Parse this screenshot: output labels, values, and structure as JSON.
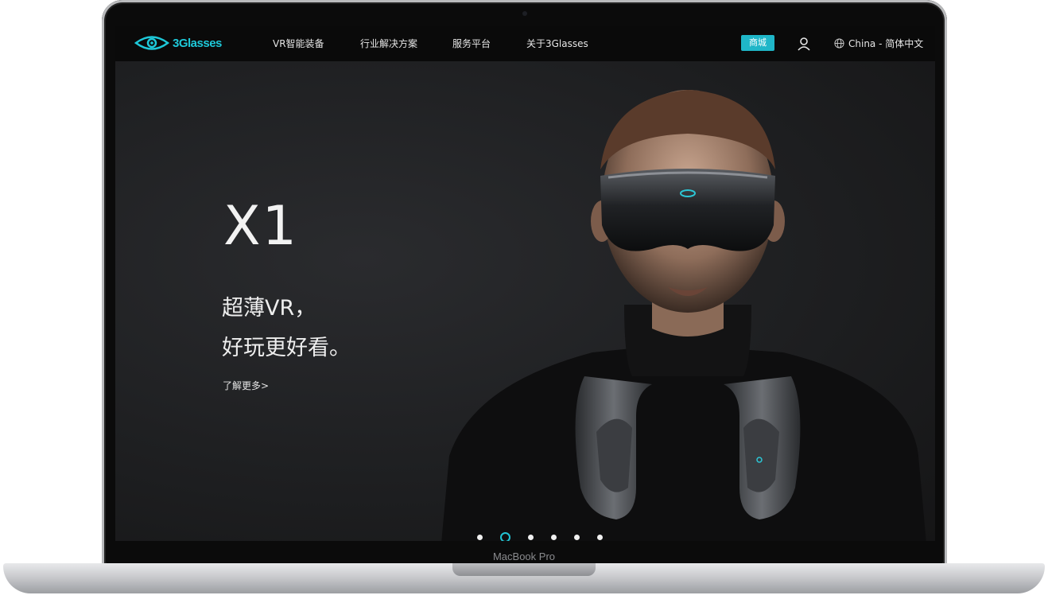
{
  "nav": {
    "logo_text": "3Glasses",
    "items": [
      {
        "label": "VR智能装备"
      },
      {
        "label": "行业解决方案"
      },
      {
        "label": "服务平台"
      },
      {
        "label": "关于3Glasses"
      }
    ],
    "shop_label": "商城",
    "language_label": "China - 简体中文"
  },
  "hero": {
    "title": "X1",
    "subtitle_line1": "超薄VR，",
    "subtitle_line2": "好玩更好看。",
    "more_link": "了解更多>"
  },
  "carousel": {
    "count": 6,
    "active_index": 1
  },
  "device": {
    "model_label": "MacBook Pro"
  },
  "colors": {
    "accent": "#1fb6c8",
    "nav_bg": "#0a0a0a",
    "hero_bg": "#1e1f21"
  },
  "icons": [
    "eye-logo-icon",
    "user-icon",
    "globe-icon"
  ]
}
